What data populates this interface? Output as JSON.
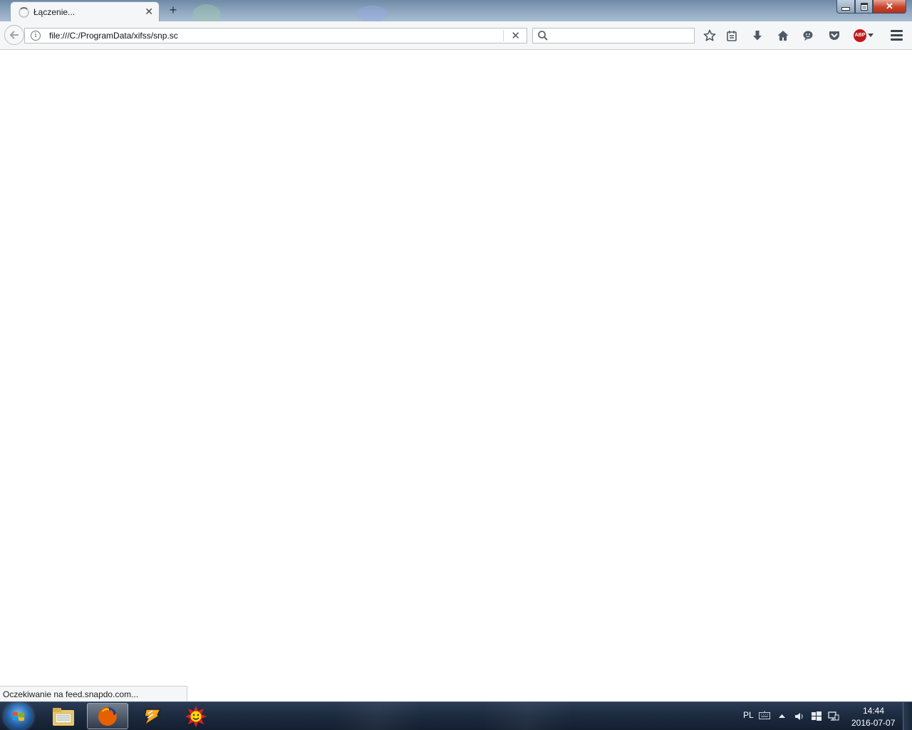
{
  "browser": {
    "tab": {
      "title": "Łączenie...",
      "close_label": "✕",
      "loading_icon": "spinner-icon"
    },
    "new_tab_label": "+",
    "window_controls": {
      "minimize_icon": "minimize-icon",
      "maximize_icon": "restore-icon",
      "close_label": "✕"
    },
    "navbar": {
      "back_icon": "back-arrow-icon",
      "info_icon_label": "i",
      "url": "file:///C:/ProgramData/xifss/snp.sc",
      "stop_label": "✕",
      "search_placeholder": "",
      "icons": [
        "star-icon",
        "reading-list-icon",
        "download-icon",
        "home-icon",
        "chat-icon",
        "pocket-icon",
        "adblock-icon",
        "menu-icon"
      ],
      "adblock_label": "ABP"
    },
    "status": "Oczekiwanie na feed.snapdo.com..."
  },
  "taskbar": {
    "apps": [
      "windows-explorer",
      "firefox",
      "winamp",
      "weather-sun"
    ],
    "tray": {
      "language": "PL",
      "time": "14:44",
      "date": "2016-07-07"
    }
  },
  "colors": {
    "accent": "#c0181a",
    "taskbar": "#1c2a3f",
    "toolbar": "#f5f6f7"
  }
}
